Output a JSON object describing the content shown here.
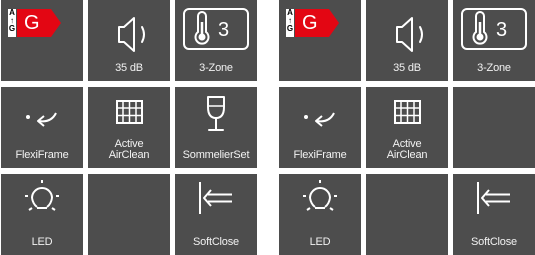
{
  "left_panel": {
    "energy": {
      "scale_top": "A",
      "scale_arrow": "↑",
      "scale_bottom": "G",
      "class": "G",
      "color": "#e30613"
    },
    "noise": {
      "label": "35 dB"
    },
    "zones": {
      "number": "3",
      "label": "3-Zone"
    },
    "flexiframe": {
      "label": "FlexiFrame"
    },
    "airclean": {
      "label_line1": "Active",
      "label_line2": "AirClean"
    },
    "sommelier": {
      "label": "SommelierSet"
    },
    "led": {
      "label": "LED"
    },
    "softclose": {
      "label": "SoftClose"
    }
  },
  "right_panel": {
    "energy": {
      "scale_top": "A",
      "scale_arrow": "↑",
      "scale_bottom": "G",
      "class": "G",
      "color": "#e30613"
    },
    "noise": {
      "label": "35 dB"
    },
    "zones": {
      "number": "3",
      "label": "3-Zone"
    },
    "flexiframe": {
      "label": "FlexiFrame"
    },
    "airclean": {
      "label_line1": "Active",
      "label_line2": "AirClean"
    },
    "led": {
      "label": "LED"
    },
    "softclose": {
      "label": "SoftClose"
    }
  },
  "colors": {
    "tile_bg": "#4d4d4d",
    "icon": "#ffffff",
    "text": "#f2f2f2",
    "energy_red": "#e30613"
  }
}
